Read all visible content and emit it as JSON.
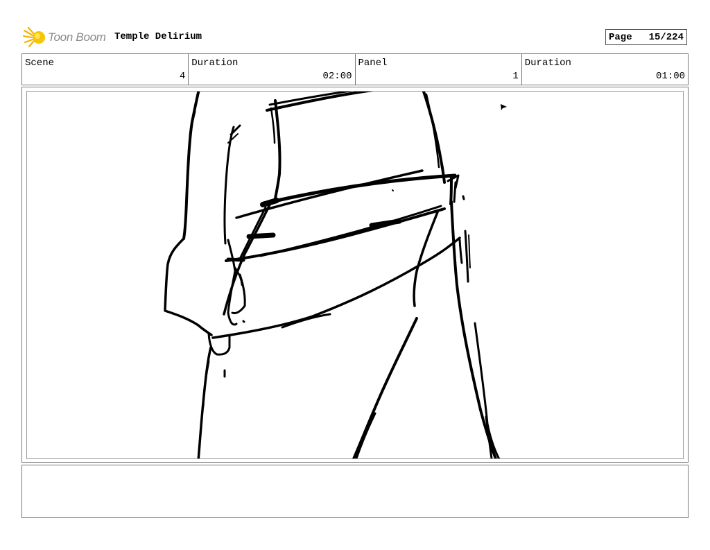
{
  "header": {
    "logo_text": "Toon Boom",
    "title": "Temple Delirium",
    "page_label": "Page",
    "page_number": "15/224"
  },
  "info": {
    "scene_label": "Scene",
    "scene_value": "4",
    "scene_duration_label": "Duration",
    "scene_duration_value": "02:00",
    "panel_label": "Panel",
    "panel_value": "1",
    "panel_duration_label": "Duration",
    "panel_duration_value": "01:00"
  },
  "notes": {
    "text": ""
  }
}
